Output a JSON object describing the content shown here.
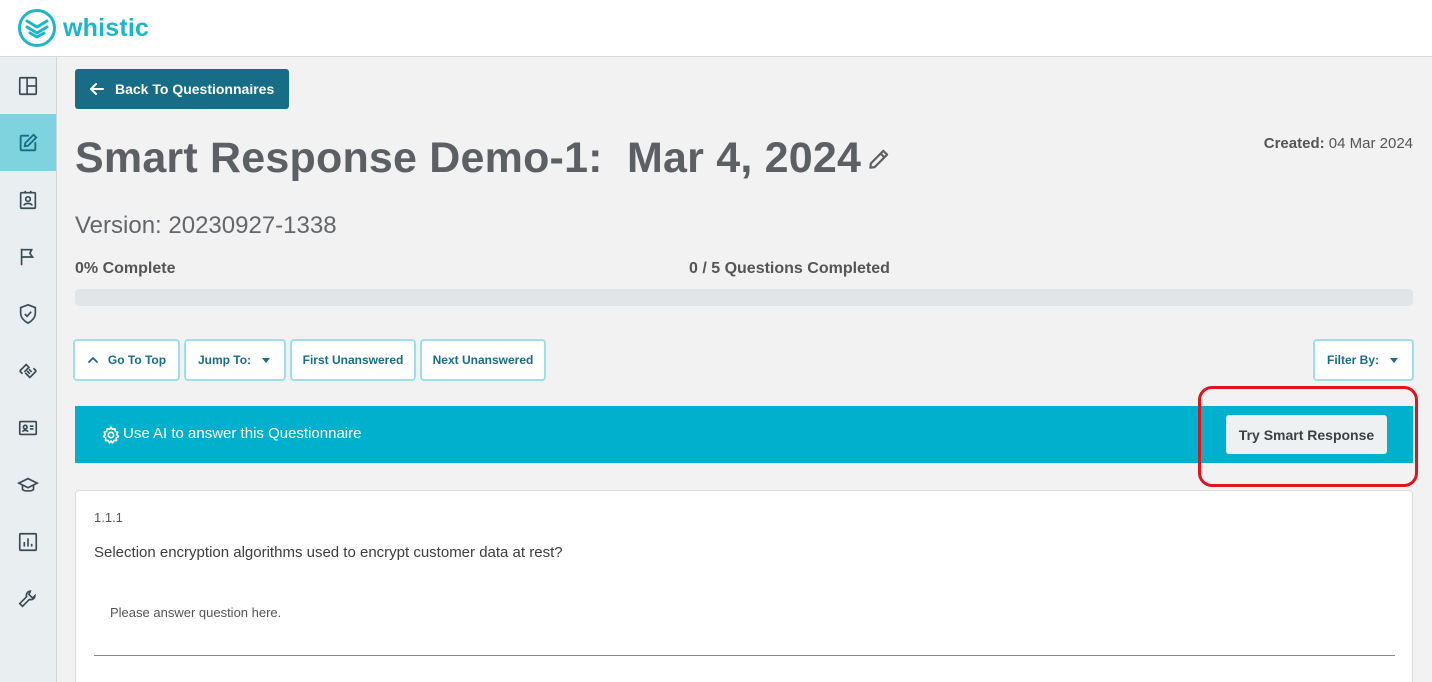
{
  "brand": {
    "name": "whistic",
    "color": "#1bb6c9"
  },
  "sidebar": {
    "items": [
      {
        "icon": "dashboard-layout-icon",
        "active": false
      },
      {
        "icon": "edit-document-icon",
        "active": true
      },
      {
        "icon": "contact-badge-icon",
        "active": false
      },
      {
        "icon": "flag-icon",
        "active": false
      },
      {
        "icon": "shield-check-icon",
        "active": false
      },
      {
        "icon": "handshake-icon",
        "active": false
      },
      {
        "icon": "id-card-icon",
        "active": false
      },
      {
        "icon": "graduation-cap-icon",
        "active": false
      },
      {
        "icon": "bar-chart-icon",
        "active": false
      },
      {
        "icon": "wrench-icon",
        "active": false
      }
    ]
  },
  "header": {
    "back_label": "Back To Questionnaires",
    "title": "Smart Response Demo-1:  Mar 4, 2024",
    "created_label": "Created:",
    "created_value": " 04 Mar 2024",
    "version": "Version: 20230927-1338"
  },
  "progress": {
    "percent_label": "0% Complete",
    "questions_label": "0 / 5 Questions Completed",
    "fraction": 0
  },
  "toolbar": {
    "go_to_top": "Go To Top",
    "jump_to": "Jump To:",
    "first_unanswered": "First Unanswered",
    "next_unanswered": "Next Unanswered",
    "filter_by": "Filter By:"
  },
  "ai_banner": {
    "text": "Use AI to answer this Questionnaire",
    "button": "Try Smart Response",
    "color": "#00b0cc"
  },
  "question": {
    "number": "1.1.1",
    "text": "Selection encryption algorithms used to encrypt customer data at rest?",
    "placeholder": "Please answer question here."
  }
}
